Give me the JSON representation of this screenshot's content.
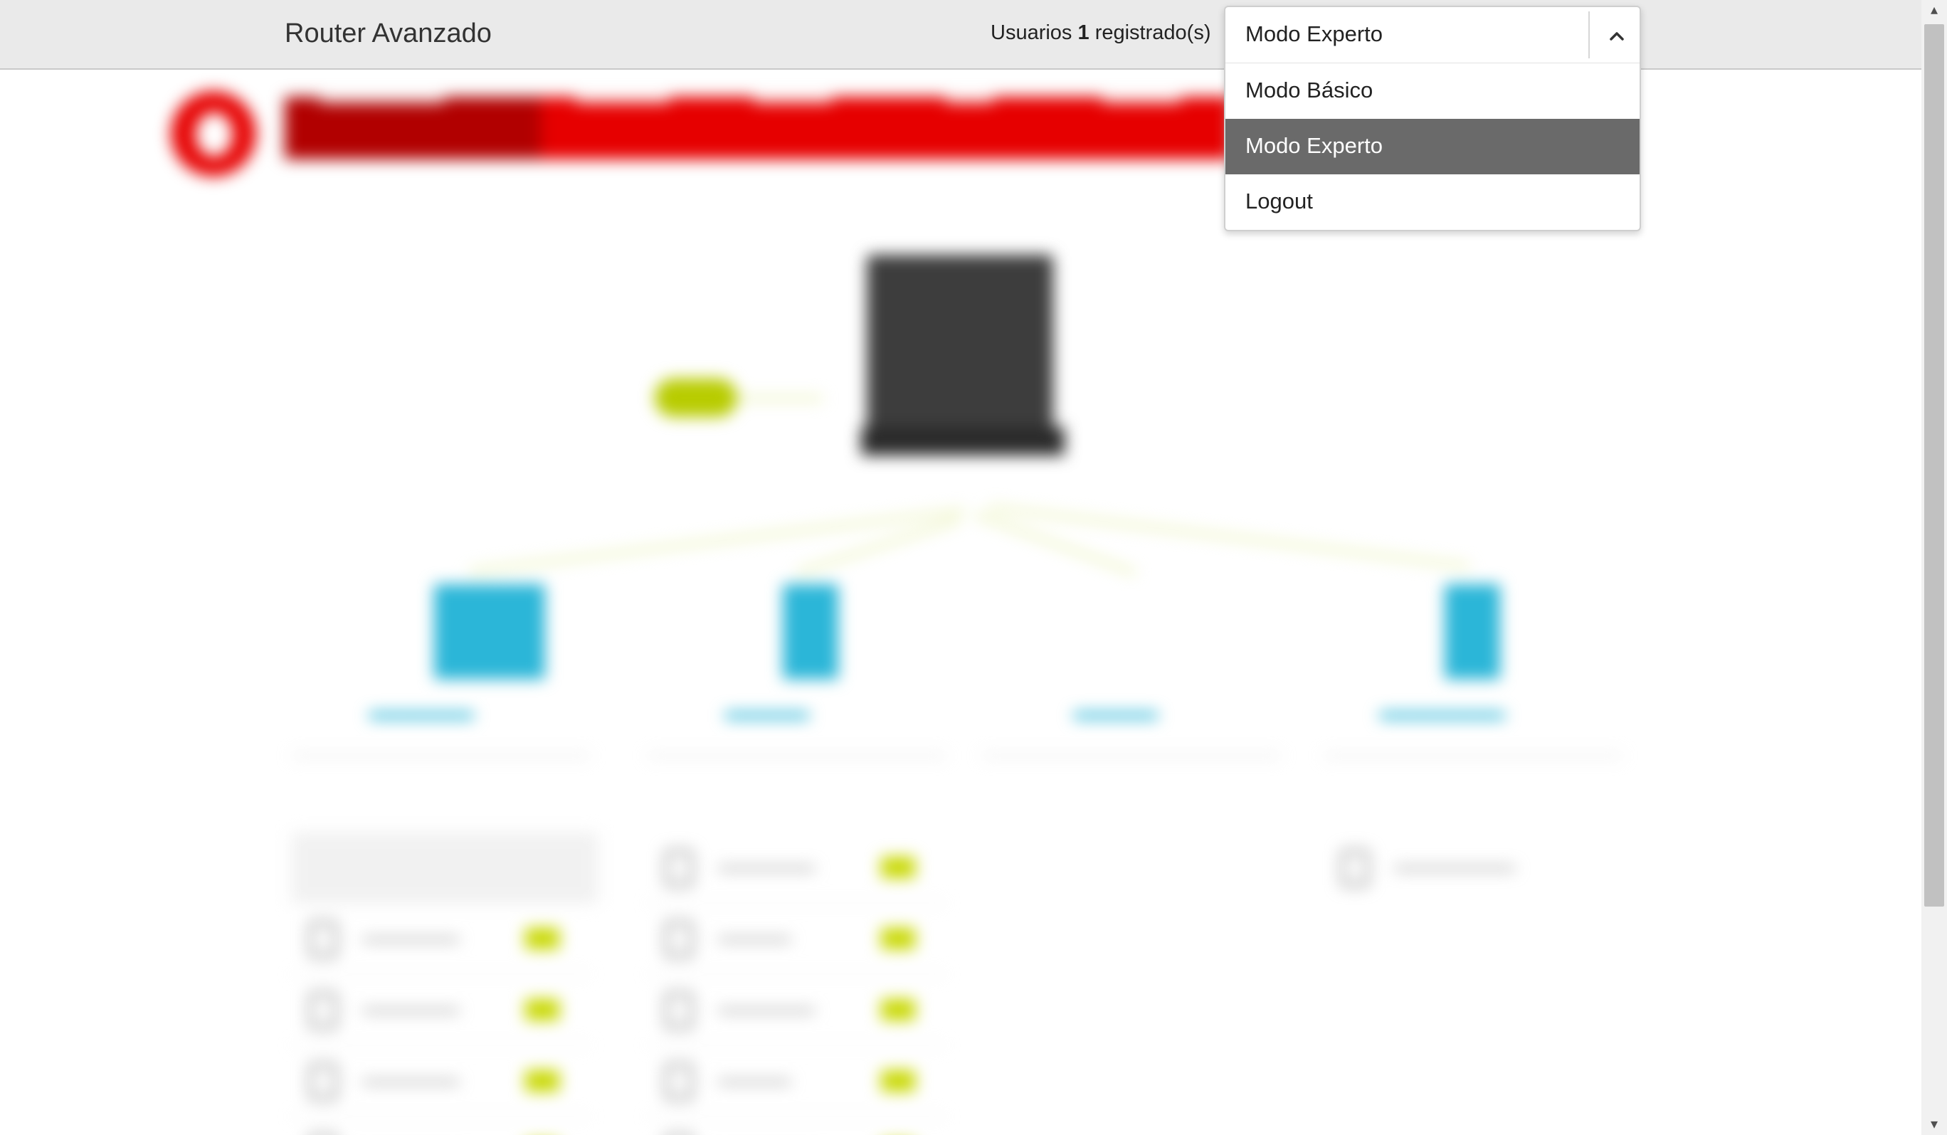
{
  "header": {
    "title": "Router Avanzado",
    "users_prefix": "Usuarios",
    "users_count": "1",
    "users_suffix": "registrado(s)"
  },
  "mode_dropdown": {
    "selected": "Modo Experto",
    "options": [
      {
        "label": "Modo Básico",
        "active": false
      },
      {
        "label": "Modo Experto",
        "active": true
      },
      {
        "label": "Logout",
        "active": false
      }
    ],
    "chevron_icon": "chevron-up-icon"
  },
  "colors": {
    "brand_red": "#e60000",
    "accent_cyan": "#2bb6d8",
    "signal_green": "#c8d800",
    "active_option_bg": "#6a6a6a"
  }
}
